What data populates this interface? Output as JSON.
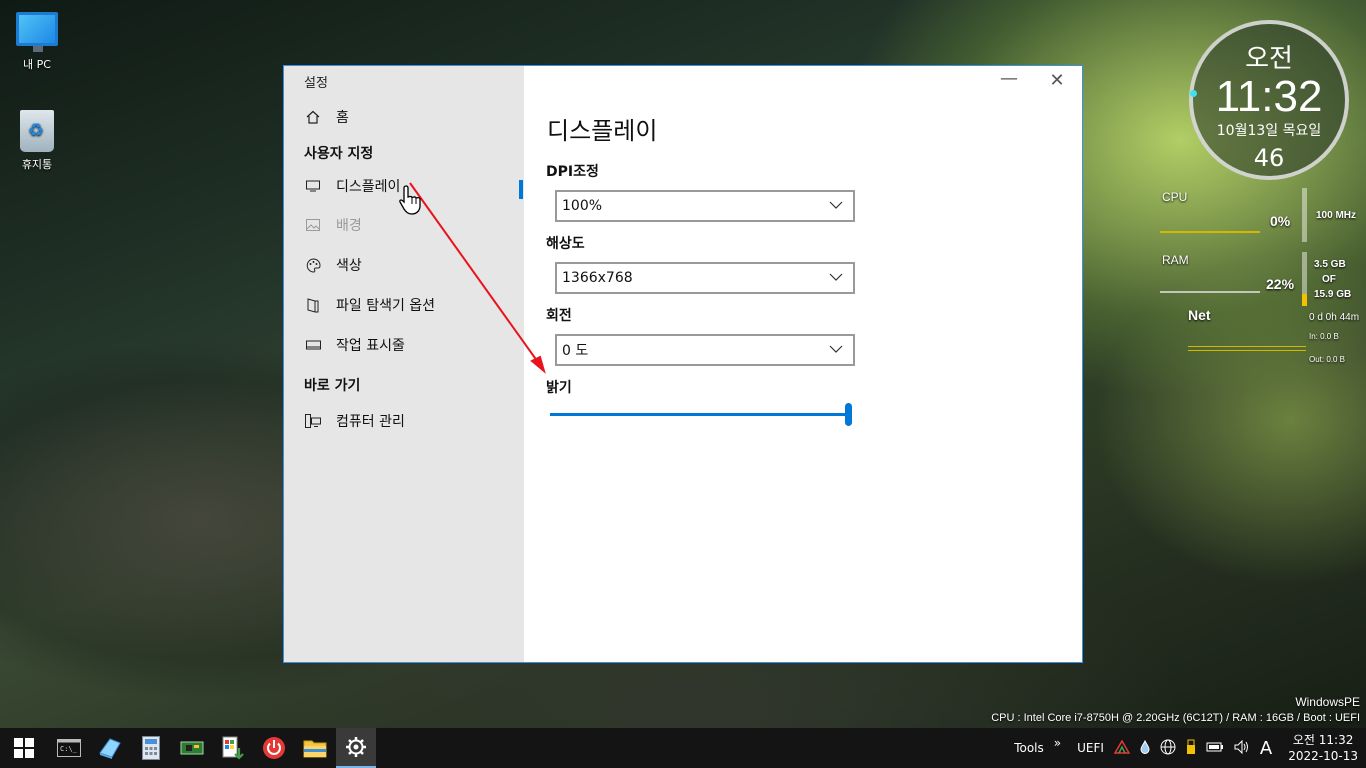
{
  "desktop": {
    "icons": [
      {
        "label": "내 PC"
      },
      {
        "label": "휴지통"
      }
    ]
  },
  "settings": {
    "app_title": "설정",
    "window_controls": {
      "minimize": "—",
      "close": "✕"
    },
    "nav": {
      "home": "홈",
      "section_custom": "사용자 지정",
      "display": "디스플레이",
      "background": "배경",
      "color": "색상",
      "explorer_options": "파일 탐색기 옵션",
      "taskbar": "작업 표시줄",
      "section_shortcuts": "바로 가기",
      "computer_management": "컴퓨터 관리"
    },
    "page": {
      "title": "디스플레이",
      "dpi_label": "DPI조정",
      "dpi_value": "100%",
      "resolution_label": "해상도",
      "resolution_value": "1366x768",
      "rotation_label": "회전",
      "rotation_value": "0 도",
      "brightness_label": "밝기",
      "brightness_level": 1.0
    }
  },
  "clock_widget": {
    "ampm": "오전",
    "time": "11:32",
    "date": "10월13일 목요일",
    "seconds": "46"
  },
  "monitor_widget": {
    "cpu_label": "CPU",
    "cpu_percent": "0%",
    "cpu_freq": "100 MHz",
    "ram_label": "RAM",
    "ram_percent": "22%",
    "ram_used": "3.5 GB",
    "ram_of": "OF",
    "ram_total": "15.9 GB",
    "net_label": "Net",
    "uptime": "0 d 0h 44m",
    "net_in": "In: 0.0 B",
    "net_out": "Out: 0.0 B"
  },
  "system_info": {
    "edition": "WindowsPE",
    "specs": "CPU : Intel Core i7-8750H @ 2.20GHz (6C12T) / RAM : 16GB / Boot : UEFI"
  },
  "taskbar": {
    "tools_label": "Tools",
    "expand_label": "»",
    "uefi_label": "UEFI",
    "ime_label": "A",
    "tray_time": "오전 11:32",
    "tray_date": "2022-10-13"
  }
}
